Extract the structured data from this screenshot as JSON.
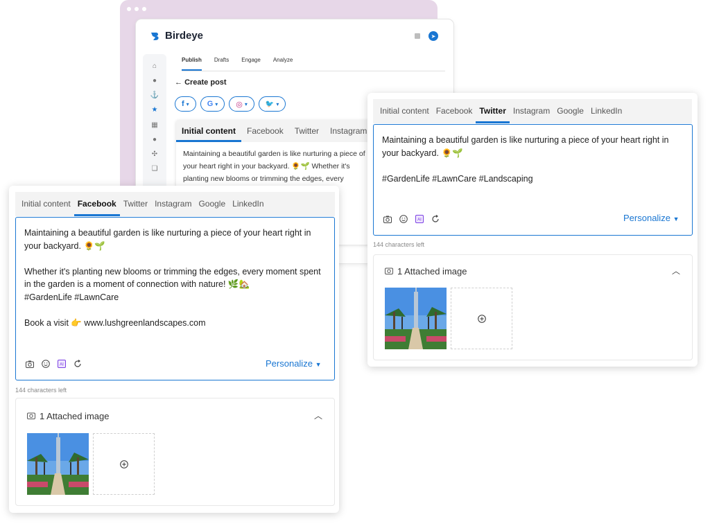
{
  "app": {
    "name": "Birdeye",
    "nav_tabs": [
      "Publish",
      "Drafts",
      "Engage",
      "Analyze"
    ],
    "create_post": "Create post",
    "sidebar_icons": [
      "home-icon",
      "chat-icon",
      "anchor-icon",
      "star-icon",
      "grid-icon",
      "dollar-icon",
      "puzzle-icon",
      "pages-icon"
    ]
  },
  "channel_chips": [
    {
      "icon": "facebook-icon",
      "glyph": "f"
    },
    {
      "icon": "google-icon",
      "glyph": "G"
    },
    {
      "icon": "instagram-icon",
      "glyph": "◎"
    },
    {
      "icon": "twitter-icon",
      "glyph": "🐦"
    }
  ],
  "background_card": {
    "tabs": [
      "Initial content",
      "Facebook",
      "Twitter",
      "Instagram"
    ],
    "active_tab": "Initial content",
    "text": "Maintaining a beautiful garden is like nurturing a piece of your heart right in your backyard. 🌻🌱 Whether it's planting new blooms or trimming the edges, every moment spent in the garden"
  },
  "facebook_card": {
    "tabs": [
      "Initial content",
      "Facebook",
      "Twitter",
      "Instagram",
      "Google",
      "LinkedIn"
    ],
    "active_tab": "Facebook",
    "text": "Maintaining a beautiful garden is like nurturing a piece of your heart right in your backyard. 🌻🌱\n\nWhether it's planting new blooms or trimming the edges, every moment spent in the garden is a moment of connection with nature! 🌿🏡\n#GardenLife #LawnCare\n\nBook a visit 👉 www.lushgreenlandscapes.com",
    "personalize": "Personalize",
    "chars_left": "144 characters left",
    "attached": "1 Attached image"
  },
  "twitter_card": {
    "tabs": [
      "Initial content",
      "Facebook",
      "Twitter",
      "Instagram",
      "Google",
      "LinkedIn"
    ],
    "active_tab": "Twitter",
    "text": "Maintaining a beautiful garden is like nurturing a piece of your heart right in your backyard. 🌻🌱\n\n#GardenLife #LawnCare #Landscaping",
    "personalize": "Personalize",
    "chars_left": "144 characters left",
    "attached": "1 Attached image"
  },
  "colors": {
    "accent": "#1976d2",
    "browser_frame": "#e7d7e8",
    "ai_badge": "#7b3fe4"
  }
}
